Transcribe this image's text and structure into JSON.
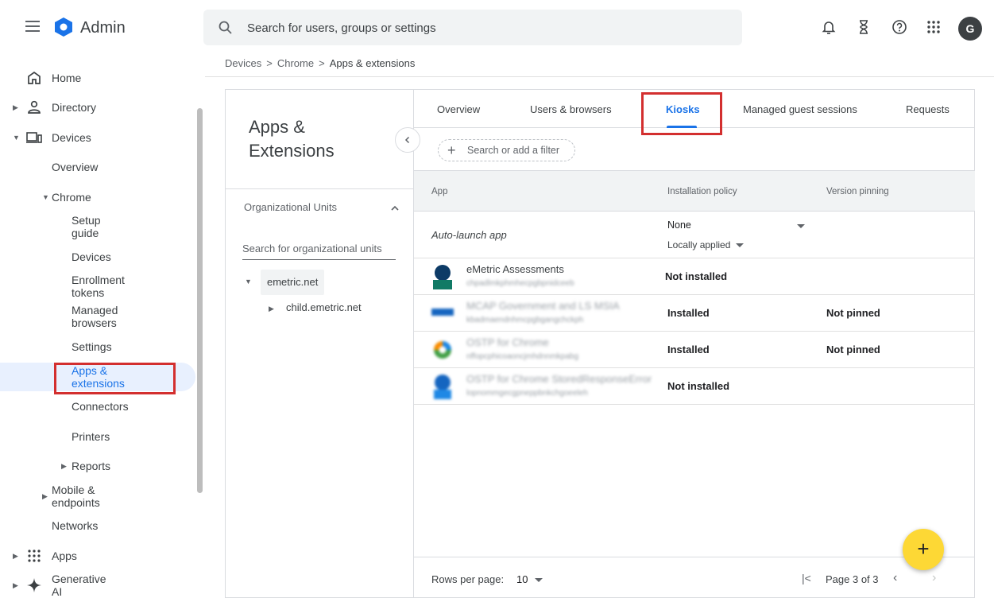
{
  "app": {
    "brand": "Admin",
    "avatar_initial": "G"
  },
  "search": {
    "placeholder": "Search for users, groups or settings"
  },
  "sidebar": {
    "items": [
      {
        "label": "Home"
      },
      {
        "label": "Directory"
      },
      {
        "label": "Devices"
      },
      {
        "label": "Overview"
      },
      {
        "label": "Chrome"
      },
      {
        "label": "Setup guide"
      },
      {
        "label": "Devices"
      },
      {
        "label": "Enrollment tokens"
      },
      {
        "label": "Managed browsers"
      },
      {
        "label": "Settings"
      },
      {
        "label": "Apps & extensions"
      },
      {
        "label": "Connectors"
      },
      {
        "label": "Printers"
      },
      {
        "label": "Reports"
      },
      {
        "label": "Mobile & endpoints"
      },
      {
        "label": "Networks"
      },
      {
        "label": "Apps"
      },
      {
        "label": "Generative AI"
      }
    ]
  },
  "breadcrumb": {
    "items": [
      "Devices",
      "Chrome",
      "Apps & extensions"
    ],
    "separator": ">"
  },
  "left_pane": {
    "title": "Apps & Extensions",
    "ou_title": "Organizational Units",
    "ou_search_placeholder": "Search for organizational units",
    "ou_root": "emetric.net",
    "ou_child": "child.emetric.net"
  },
  "tabs": [
    "Overview",
    "Users & browsers",
    "Kiosks",
    "Managed guest sessions",
    "Requests"
  ],
  "active_tab": "Kiosks",
  "filter": {
    "placeholder": "Search or add a filter"
  },
  "table": {
    "headers": [
      "App",
      "Installation policy",
      "Version pinning"
    ],
    "auto_launch": {
      "label": "Auto-launch app",
      "value": "None",
      "sub": "Locally applied"
    },
    "rows": [
      {
        "name": "eMetric Assessments",
        "id": "chpadlmkphmhecpgbpnidceeb",
        "policy": "Not installed",
        "pinning": ""
      },
      {
        "name": "MCAP Government and LS MSIA",
        "id": "kbadmaendnhmcpgbgangchckph",
        "policy": "Installed",
        "pinning": "Not pinned"
      },
      {
        "name": "OSTP for Chrome",
        "id": "nffopcphicoaoncjmhdnnmkpabg",
        "policy": "Installed",
        "pinning": "Not pinned"
      },
      {
        "name": "OSTP for Chrome StoredResponseError",
        "id": "lopnommgecgpneppbnkchgoeeleh",
        "policy": "Not installed",
        "pinning": ""
      }
    ]
  },
  "pagination": {
    "rows_label": "Rows per page:",
    "rows_value": "10",
    "page_label": "Page 3 of 3"
  },
  "colors": {
    "accent": "#1a73e8",
    "highlight": "#d32f2f",
    "fab": "#fdd835"
  }
}
